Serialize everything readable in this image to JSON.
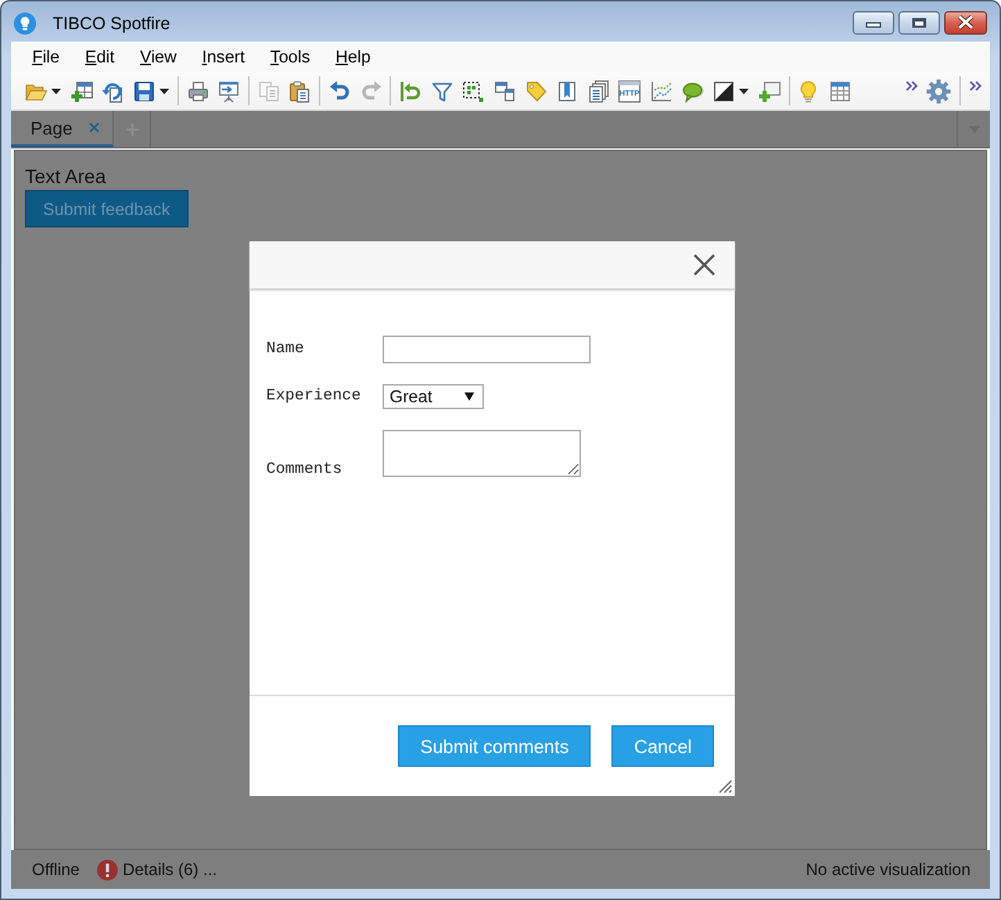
{
  "window": {
    "title": "TIBCO Spotfire"
  },
  "menu": [
    {
      "label": "File"
    },
    {
      "label": "Edit"
    },
    {
      "label": "View"
    },
    {
      "label": "Insert"
    },
    {
      "label": "Tools"
    },
    {
      "label": "Help"
    }
  ],
  "toolbar": {
    "groups": [
      {
        "items": [
          {
            "kind": "folder",
            "dropdown": true,
            "disabled": false
          },
          {
            "kind": "tableplus",
            "dropdown": false,
            "disabled": false
          },
          {
            "kind": "refresh",
            "dropdown": false,
            "disabled": false
          },
          {
            "kind": "save",
            "dropdown": true,
            "disabled": false
          }
        ]
      },
      {
        "items": [
          {
            "kind": "print",
            "dropdown": false,
            "disabled": false
          },
          {
            "kind": "export",
            "dropdown": false,
            "disabled": false
          }
        ]
      },
      {
        "items": [
          {
            "kind": "copy",
            "dropdown": false,
            "disabled": true
          },
          {
            "kind": "paste",
            "dropdown": false,
            "disabled": false
          }
        ]
      },
      {
        "items": [
          {
            "kind": "undo",
            "dropdown": false,
            "disabled": false
          },
          {
            "kind": "redo",
            "dropdown": false,
            "disabled": true
          }
        ]
      },
      {
        "items": [
          {
            "kind": "reset",
            "dropdown": false,
            "disabled": false
          },
          {
            "kind": "filter",
            "dropdown": false,
            "disabled": false
          },
          {
            "kind": "marking",
            "dropdown": false,
            "disabled": false
          },
          {
            "kind": "windows",
            "dropdown": false,
            "disabled": false
          },
          {
            "kind": "tag",
            "dropdown": false,
            "disabled": false
          },
          {
            "kind": "bookmark",
            "dropdown": false,
            "disabled": false
          },
          {
            "kind": "documents",
            "dropdown": false,
            "disabled": false
          },
          {
            "kind": "web",
            "label": "HTTP",
            "dropdown": false,
            "disabled": false
          },
          {
            "kind": "trend",
            "dropdown": false,
            "disabled": false
          },
          {
            "kind": "bubble",
            "dropdown": false,
            "disabled": false
          },
          {
            "kind": "contrast",
            "dropdown": true,
            "disabled": false
          },
          {
            "kind": "addvis",
            "dropdown": false,
            "disabled": false
          }
        ]
      },
      {
        "items": [
          {
            "kind": "bulb",
            "dropdown": false,
            "disabled": false
          },
          {
            "kind": "grid",
            "dropdown": false,
            "disabled": false
          }
        ]
      }
    ],
    "end_groups": [
      {
        "items": [
          {
            "kind": "overflow",
            "dropdown": false,
            "disabled": false
          },
          {
            "kind": "gear",
            "dropdown": false,
            "disabled": false
          }
        ]
      },
      {
        "items": [
          {
            "kind": "overflow",
            "dropdown": false,
            "disabled": false
          }
        ]
      }
    ]
  },
  "tabs": [
    {
      "label": "Page",
      "selected": true
    }
  ],
  "page": {
    "title": "Text Area",
    "button": "Submit feedback"
  },
  "dialog": {
    "fields": [
      {
        "kind": "text",
        "label": "Name"
      },
      {
        "kind": "select",
        "label": "Experience",
        "value": "Great"
      },
      {
        "kind": "textarea",
        "label": "Comments"
      }
    ],
    "buttons": [
      {
        "label": "Submit comments"
      },
      {
        "label": "Cancel"
      }
    ]
  },
  "status_bar": {
    "connection": "Offline",
    "details": "Details (6) ...",
    "visualization": "No active visualization"
  }
}
